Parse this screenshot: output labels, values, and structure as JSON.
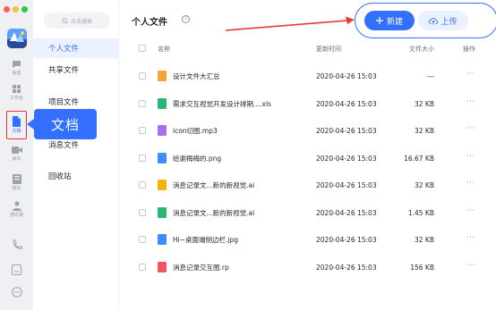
{
  "colors": {
    "accent": "#3370ff",
    "highlight_red": "#e53935"
  },
  "rail": {
    "items": [
      {
        "icon": "chat-icon",
        "label": "会话"
      },
      {
        "icon": "workbench-icon",
        "label": "工作台"
      },
      {
        "icon": "docs-icon",
        "label": "文档"
      },
      {
        "icon": "meeting-icon",
        "label": "会议"
      },
      {
        "icon": "knowledge-icon",
        "label": "知识"
      },
      {
        "icon": "contacts-icon",
        "label": "通讯录"
      },
      {
        "icon": "phone-icon",
        "label": ""
      },
      {
        "icon": "file-icon",
        "label": ""
      },
      {
        "icon": "more-icon",
        "label": ""
      }
    ]
  },
  "callout": {
    "label": "文档"
  },
  "sidebar": {
    "search_placeholder": "点击搜索",
    "items": [
      {
        "label": "个人文件"
      },
      {
        "label": "共享文件"
      },
      {
        "label": "项目文件"
      },
      {
        "label": "消息文件"
      },
      {
        "label": "回收站"
      }
    ]
  },
  "main": {
    "title": "个人文件",
    "help": "?",
    "new_button": "新建",
    "upload_button": "上传",
    "columns": {
      "name": "名称",
      "time": "更新时间",
      "size": "文件大小",
      "action": "操作"
    },
    "files": [
      {
        "name": "设计文件大汇总",
        "time": "2020-04-26 15:03",
        "size": "---",
        "action": "···",
        "icon_color": "#f7a23b"
      },
      {
        "name": "需求交互视觉开发设计排期....xls",
        "time": "2020-04-26 15:03",
        "size": "32 KB",
        "action": "···",
        "icon_color": "#2ab675"
      },
      {
        "name": "icon切图.mp3",
        "time": "2020-04-26 15:03",
        "size": "32 KB",
        "action": "···",
        "icon_color": "#a86ef0"
      },
      {
        "name": "给谢梅梅的.png",
        "time": "2020-04-26 15:03",
        "size": "16.67 KB",
        "action": "···",
        "icon_color": "#3c8cff"
      },
      {
        "name": "消息记录文...新的新视觉.ai",
        "time": "2020-04-26 15:03",
        "size": "32 KB",
        "action": "···",
        "icon_color": "#f5b400"
      },
      {
        "name": "消息记录文...新的新视觉.ai",
        "time": "2020-04-26 15:03",
        "size": "1.45 KB",
        "action": "···",
        "icon_color": "#2ab675"
      },
      {
        "name": "Hi~桌面端侧边栏.jpg",
        "time": "2020-04-26 15:03",
        "size": "32 KB",
        "action": "···",
        "icon_color": "#3c8cff"
      },
      {
        "name": "消息记录交互图.rp",
        "time": "2020-04-26 15:03",
        "size": "156 KB",
        "action": "···",
        "icon_color": "#f0565c"
      }
    ]
  }
}
